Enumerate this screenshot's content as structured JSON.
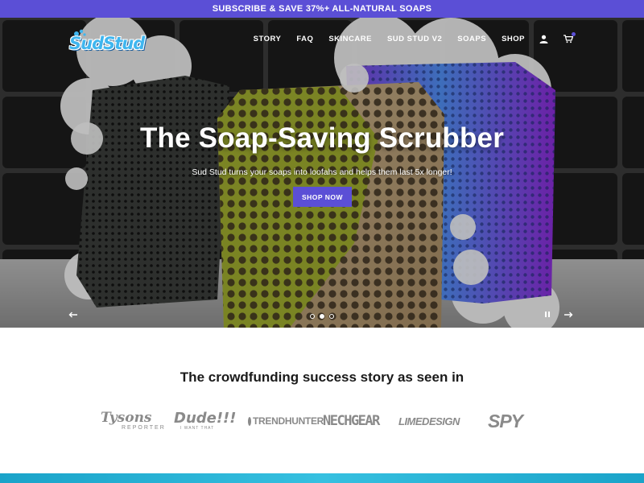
{
  "announcement": "SUBSCRIBE & SAVE 37%+ ALL-NATURAL SOAPS",
  "header": {
    "logo_text": "SudStud",
    "nav": [
      "STORY",
      "FAQ",
      "SKINCARE",
      "SUD STUD V2",
      "SOAPS",
      "SHOP"
    ],
    "icons": [
      "user-icon",
      "cart-icon"
    ]
  },
  "hero": {
    "title": "The Soap-Saving Scrubber",
    "subtitle": "Sud Stud turns your soaps into loofahs and helps them last 5x longer!",
    "cta": "SHOP NOW",
    "slides_total": 3,
    "slide_active": 2
  },
  "press": {
    "heading": "The crowdfunding success story as seen in",
    "logos": [
      {
        "main": "Tysons",
        "sub": "REPORTER"
      },
      {
        "main": "Dude!!!",
        "sub": "I WANT THAT"
      },
      {
        "main": "TRENDHUNTER",
        "sub": ""
      },
      {
        "main": "NECHGEAR",
        "sub": ""
      },
      {
        "main": "LIMEDESIGN",
        "sub": ""
      },
      {
        "main": "SPY",
        "sub": ""
      }
    ]
  },
  "colors": {
    "accent": "#5b4fd6",
    "logo_blue": "#3fb6ef",
    "bottom_strip": "#1aa3c9"
  }
}
